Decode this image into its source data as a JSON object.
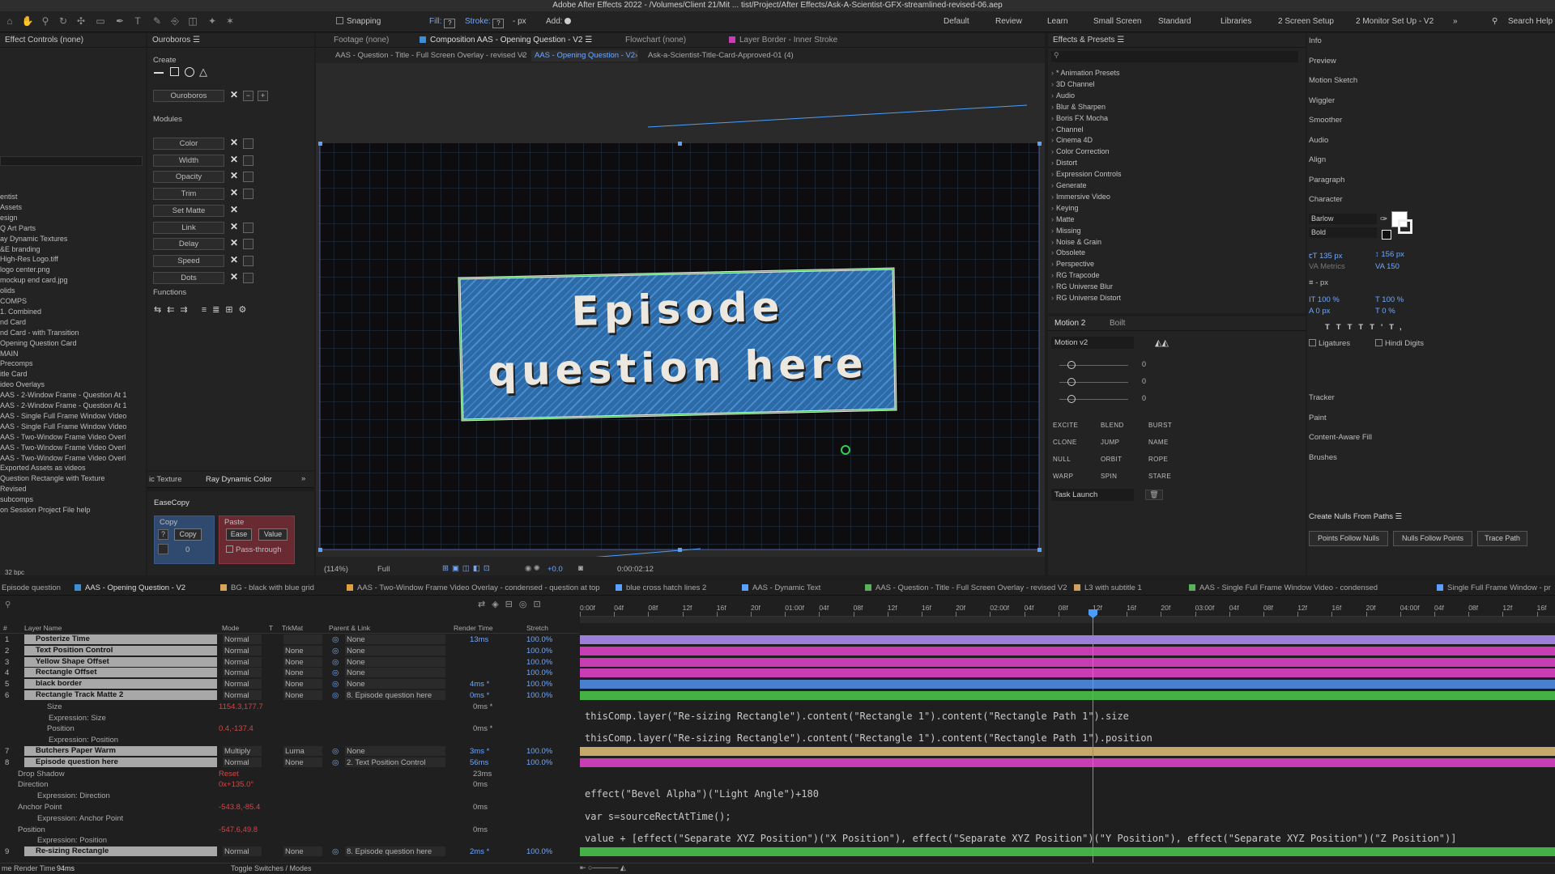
{
  "app": {
    "title": "Adobe After Effects 2022 - /Volumes/Client 21/Mit ... tist/Project/After Effects/Ask-A-Scientist-GFX-streamlined-revised-06.aep"
  },
  "toolbar": {
    "snapping": "Snapping",
    "fill": "Fill:",
    "stroke": "Stroke:",
    "stroke_px": "- px",
    "add": "Add:",
    "workspaces": [
      "Default",
      "Review",
      "Learn",
      "Small Screen",
      "Standard",
      "Libraries",
      "2 Screen Setup",
      "2 Monitor Set Up - V2"
    ],
    "search": "Search Help"
  },
  "effect_controls": {
    "title": "Effect Controls (none)"
  },
  "project": {
    "items": [
      "entist",
      "Assets",
      "esign",
      "Q Art Parts",
      "ay Dynamic Textures",
      "&E branding",
      "High-Res Logo.tiff",
      "logo center.png",
      "mockup end card.jpg",
      "olids",
      "COMPS",
      "1. Combined",
      "nd Card",
      "nd Card - with Transition",
      "Opening Question Card",
      "MAIN",
      "Precomps",
      "itle Card",
      "ideo Overlays",
      "AAS - 2-Window Frame - Question At 1",
      "AAS - 2-Window Frame - Question At 1",
      "AAS - Single Full Frame Window Video",
      "AAS - Single Full Frame Window Video",
      "AAS - Two-Window Frame Video Overl",
      "AAS - Two-Window Frame Video Overl",
      "AAS - Two-Window Frame Video Overl",
      "Exported Assets as videos",
      "Question Rectangle with Texture",
      "Revised",
      "subcomps",
      "on Session Project File help"
    ],
    "bpc": "32 bpc"
  },
  "ouroboros": {
    "title": "Ouroboros",
    "create": "Create",
    "name_btn": "Ouroboros",
    "modules_label": "Modules",
    "modules": [
      "Color",
      "Width",
      "Opacity",
      "Trim",
      "Set Matte",
      "Link",
      "Delay",
      "Speed",
      "Dots"
    ],
    "functions": "Functions"
  },
  "mini_tabs": {
    "texture": "ic Texture",
    "dyncolor": "Ray Dynamic Color"
  },
  "easecopy": {
    "title": "EaseCopy",
    "copy_label": "Copy",
    "copy_btn": "Copy",
    "q": "?",
    "zero": "0",
    "paste_label": "Paste",
    "ease": "Ease",
    "value": "Value",
    "pass": "Pass-through"
  },
  "comp": {
    "tabs": [
      "Footage (none)",
      "Composition AAS - Opening Question - V2",
      "Flowchart (none)",
      "Layer Border - Inner Stroke"
    ],
    "breadcrumbs": [
      "AAS - Question - Title - Full Screen Overlay - revised V2",
      "AAS - Opening Question - V2",
      "Ask-a-Scientist-Title-Card-Approved-01 (4)"
    ],
    "line1": "Episode",
    "line2": "question here",
    "zoom": "(114%)",
    "res": "Full",
    "exposure": "+0.0",
    "time": "0:00:02:12"
  },
  "effects": {
    "title": "Effects & Presets",
    "items": [
      "* Animation Presets",
      "3D Channel",
      "Audio",
      "Blur & Sharpen",
      "Boris FX Mocha",
      "Channel",
      "Cinema 4D",
      "Color Correction",
      "Distort",
      "Expression Controls",
      "Generate",
      "Immersive Video",
      "Keying",
      "Matte",
      "Missing",
      "Noise & Grain",
      "Obsolete",
      "Perspective",
      "RG Trapcode",
      "RG Universe Blur",
      "RG Universe Distort"
    ]
  },
  "motion": {
    "tabs": [
      "Motion 2",
      "Boilt"
    ],
    "preset": "Motion v2",
    "zero": "0",
    "tools": [
      "EXCITE",
      "BLEND",
      "BURST",
      "CLONE",
      "JUMP",
      "NAME",
      "NULL",
      "ORBIT",
      "ROPE",
      "WARP",
      "SPIN",
      "STARE"
    ],
    "task": "Task Launch"
  },
  "right": {
    "items": [
      "Info",
      "Preview",
      "Motion Sketch",
      "Wiggler",
      "Smoother",
      "Audio",
      "Align",
      "Paragraph",
      "Character"
    ],
    "font": "Barlow",
    "style": "Bold",
    "size": "135 px",
    "leading": "156 px",
    "kern": "Metrics",
    "track": "150",
    "stroke": "- px",
    "vscale": "100 %",
    "hscale": "100 %",
    "baseline": "0 px",
    "tsume": "0 %",
    "ligatures": "Ligatures",
    "hindi": "Hindi Digits",
    "lower": [
      "Tracker",
      "Paint",
      "Content-Aware Fill",
      "Brushes"
    ],
    "nulls_title": "Create Nulls From Paths",
    "nulls_btns": [
      "Points Follow Nulls",
      "Nulls Follow Points",
      "Trace Path"
    ]
  },
  "timeline": {
    "tabs": [
      "Episode question",
      "AAS - Opening Question - V2",
      "BG - black with blue grid",
      "AAS - Two-Window Frame Video Overlay - condensed - question at top",
      "blue cross hatch lines 2",
      "AAS - Dynamic Text",
      "AAS - Question - Title - Full Screen Overlay - revised V2",
      "L3 with subtitle 1",
      "AAS - Single Full Frame Window Video - condensed",
      "Single Full Frame Window - pr"
    ],
    "tab_colors": [
      "#777",
      "#3a8fd8",
      "#d9a45a",
      "#e0a040",
      "#5aa0ff",
      "#5aa0ff",
      "#5ab060",
      "#d0a060",
      "#5ab060",
      "#5aa0ff"
    ],
    "headers": [
      "#",
      "Layer Name",
      "Mode",
      "T",
      "TrkMat",
      "Parent & Link",
      "Render Time",
      "Stretch"
    ],
    "ruler": [
      "0:00f",
      "04f",
      "08f",
      "12f",
      "16f",
      "20f",
      "01:00f",
      "04f",
      "08f",
      "12f",
      "16f",
      "20f",
      "02:00f",
      "04f",
      "08f",
      "12f",
      "16f",
      "20f",
      "03:00f",
      "04f",
      "08f",
      "12f",
      "16f",
      "20f",
      "04:00f",
      "04f",
      "08f",
      "12f",
      "16f"
    ],
    "layers": [
      {
        "num": "1",
        "name": "Posterize Time",
        "mode": "Normal",
        "trk": "",
        "parent": "None",
        "render": "13ms",
        "stretch": "100.0%",
        "color": "#9c7fd8"
      },
      {
        "num": "2",
        "name": "Text Position Control",
        "mode": "Normal",
        "trk": "None",
        "parent": "None",
        "render": "",
        "stretch": "100.0%",
        "color": "#c83cb4"
      },
      {
        "num": "3",
        "name": "Yellow Shape Offset",
        "mode": "Normal",
        "trk": "None",
        "parent": "None",
        "render": "",
        "stretch": "100.0%",
        "color": "#c83cb4"
      },
      {
        "num": "4",
        "name": "Rectangle Offset",
        "mode": "Normal",
        "trk": "None",
        "parent": "None",
        "render": "",
        "stretch": "100.0%",
        "color": "#c83cb4"
      },
      {
        "num": "5",
        "name": "black border",
        "mode": "Normal",
        "trk": "None",
        "parent": "None",
        "render": "4ms *",
        "stretch": "100.0%",
        "color": "#4a7fd0"
      },
      {
        "num": "6",
        "name": "Rectangle Track Matte 2",
        "mode": "Normal",
        "trk": "None",
        "parent": "8. Episode question here",
        "render": "0ms *",
        "stretch": "100.0%",
        "color": "#45b045"
      }
    ],
    "sub6": [
      {
        "label": "Size",
        "value": "1154.3,177.7",
        "render": "0ms *"
      },
      {
        "label": "Expression: Size",
        "value": "",
        "render": ""
      },
      {
        "label": "Position",
        "value": "0.4,-137.4",
        "render": "0ms *"
      },
      {
        "label": "Expression: Position",
        "value": "",
        "render": ""
      }
    ],
    "layers2": [
      {
        "num": "7",
        "name": "Butchers Paper Warm",
        "mode": "Multiply",
        "trk": "Luma",
        "parent": "None",
        "render": "3ms *",
        "stretch": "100.0%",
        "color": "#c6a96a"
      },
      {
        "num": "8",
        "name": "Episode question here",
        "mode": "Normal",
        "trk": "None",
        "parent": "2. Text Position Control",
        "render": "56ms",
        "stretch": "100.0%",
        "color": "#c83cb4"
      }
    ],
    "sub8": [
      {
        "label": "Drop Shadow",
        "value": "Reset",
        "render": "23ms"
      },
      {
        "label": "Direction",
        "value": "0x+135.0°",
        "render": "0ms"
      },
      {
        "label": "Expression: Direction",
        "value": "",
        "render": ""
      },
      {
        "label": "Anchor Point",
        "value": "-543.8,-85.4",
        "render": "0ms"
      },
      {
        "label": "Expression: Anchor Point",
        "value": "",
        "render": ""
      },
      {
        "label": "Position",
        "value": "-547.6,49.8",
        "render": "0ms"
      },
      {
        "label": "Expression: Position",
        "value": "",
        "render": ""
      }
    ],
    "layer9": {
      "num": "9",
      "name": "Re-sizing Rectangle",
      "mode": "Normal",
      "trk": "None",
      "parent": "8. Episode question here",
      "render": "2ms *",
      "stretch": "100.0%",
      "color": "#45b045"
    },
    "expressions": [
      "thisComp.layer(\"Re-sizing Rectangle\").content(\"Rectangle 1\").content(\"Rectangle Path 1\").size",
      "thisComp.layer(\"Re-sizing Rectangle\").content(\"Rectangle 1\").content(\"Rectangle Path 1\").position",
      "effect(\"Bevel Alpha\")(\"Light Angle\")+180",
      "var s=sourceRectAtTime();",
      "value + [effect(\"Separate XYZ Position\")(\"X Position\"), effect(\"Separate XYZ Position\")(\"Y Position\"), effect(\"Separate XYZ Position\")(\"Z Position\")]"
    ],
    "footer_left": "me Render Time",
    "footer_time": "94ms",
    "footer_toggle": "Toggle Switches / Modes"
  }
}
